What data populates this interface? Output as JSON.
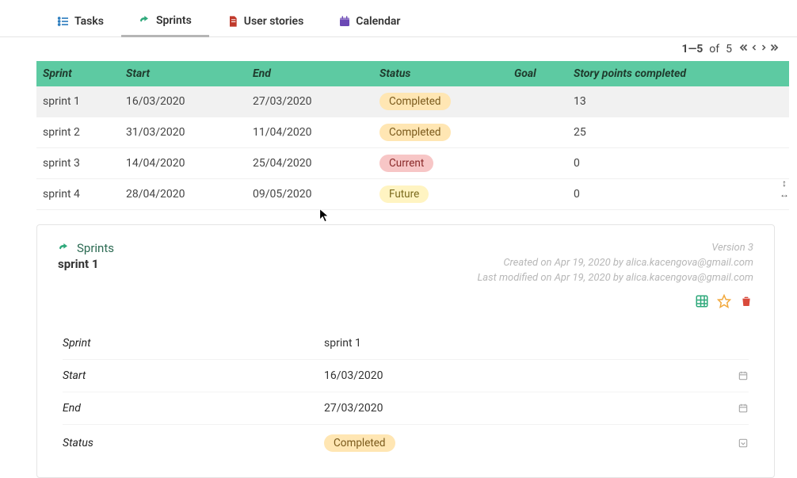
{
  "tabs": {
    "tasks": "Tasks",
    "sprints": "Sprints",
    "stories": "User stories",
    "calendar": "Calendar"
  },
  "pager": {
    "range": "1—5",
    "of_label": "of",
    "total": "5"
  },
  "table": {
    "headers": {
      "sprint": "Sprint",
      "start": "Start",
      "end": "End",
      "status": "Status",
      "goal": "Goal",
      "points": "Story points completed"
    },
    "rows": [
      {
        "sprint": "sprint 1",
        "start": "16/03/2020",
        "end": "27/03/2020",
        "status": "Completed",
        "status_kind": "completed",
        "goal": "",
        "points": "13"
      },
      {
        "sprint": "sprint 2",
        "start": "31/03/2020",
        "end": "11/04/2020",
        "status": "Completed",
        "status_kind": "completed",
        "goal": "",
        "points": "25"
      },
      {
        "sprint": "sprint 3",
        "start": "14/04/2020",
        "end": "25/04/2020",
        "status": "Current",
        "status_kind": "current",
        "goal": "",
        "points": "0"
      },
      {
        "sprint": "sprint 4",
        "start": "28/04/2020",
        "end": "09/05/2020",
        "status": "Future",
        "status_kind": "future",
        "goal": "",
        "points": "0"
      }
    ]
  },
  "detail": {
    "section_label": "Sprints",
    "record_name": "sprint 1",
    "meta": {
      "version": "Version 3",
      "created": "Created on Apr 19, 2020 by alica.kacengova@gmail.com",
      "modified": "Last modified on Apr 19, 2020 by alica.kacengova@gmail.com"
    },
    "fields": {
      "sprint_label": "Sprint",
      "sprint_value": "sprint 1",
      "start_label": "Start",
      "start_value": "16/03/2020",
      "end_label": "End",
      "end_value": "27/03/2020",
      "status_label": "Status",
      "status_value": "Completed"
    }
  }
}
